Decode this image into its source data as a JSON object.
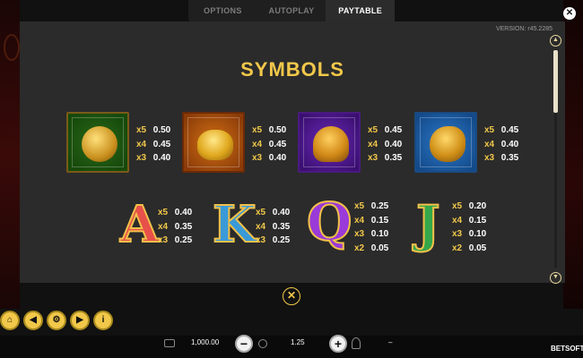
{
  "tabs": [
    {
      "label": "OPTIONS"
    },
    {
      "label": "AUTOPLAY"
    },
    {
      "label": "PAYTABLE"
    }
  ],
  "active_tab": "PAYTABLE",
  "version": "VERSION: r45.2285",
  "paytable": {
    "title": "SYMBOLS",
    "premium": [
      {
        "icon": "buddha-symbol-icon",
        "pays": [
          {
            "mul": "x5",
            "val": "0.50"
          },
          {
            "mul": "x4",
            "val": "0.45"
          },
          {
            "mul": "x3",
            "val": "0.40"
          }
        ]
      },
      {
        "icon": "gold-ingot-symbol-icon",
        "pays": [
          {
            "mul": "x5",
            "val": "0.50"
          },
          {
            "mul": "x4",
            "val": "0.45"
          },
          {
            "mul": "x3",
            "val": "0.40"
          }
        ]
      },
      {
        "icon": "gold-turtle-symbol-icon",
        "pays": [
          {
            "mul": "x5",
            "val": "0.45"
          },
          {
            "mul": "x4",
            "val": "0.40"
          },
          {
            "mul": "x3",
            "val": "0.35"
          }
        ]
      },
      {
        "icon": "money-toad-symbol-icon",
        "pays": [
          {
            "mul": "x5",
            "val": "0.45"
          },
          {
            "mul": "x4",
            "val": "0.40"
          },
          {
            "mul": "x3",
            "val": "0.35"
          }
        ]
      }
    ],
    "letters": [
      {
        "letter": "A",
        "pays": [
          {
            "mul": "x5",
            "val": "0.40"
          },
          {
            "mul": "x4",
            "val": "0.35"
          },
          {
            "mul": "x3",
            "val": "0.25"
          }
        ]
      },
      {
        "letter": "K",
        "pays": [
          {
            "mul": "x5",
            "val": "0.40"
          },
          {
            "mul": "x4",
            "val": "0.35"
          },
          {
            "mul": "x3",
            "val": "0.25"
          }
        ]
      },
      {
        "letter": "Q",
        "pays": [
          {
            "mul": "x5",
            "val": "0.25"
          },
          {
            "mul": "x4",
            "val": "0.15"
          },
          {
            "mul": "x3",
            "val": "0.10"
          },
          {
            "mul": "x2",
            "val": "0.05"
          }
        ]
      },
      {
        "letter": "J",
        "pays": [
          {
            "mul": "x5",
            "val": "0.20"
          },
          {
            "mul": "x4",
            "val": "0.15"
          },
          {
            "mul": "x3",
            "val": "0.10"
          },
          {
            "mul": "x2",
            "val": "0.05"
          }
        ]
      }
    ]
  },
  "footer": {
    "balance": "1,000.00",
    "stake": "1.25",
    "win": "–",
    "brand": "BETSOFT"
  },
  "controls": [
    {
      "icon": "home-icon"
    },
    {
      "icon": "back-icon"
    },
    {
      "icon": "settings-icon"
    },
    {
      "icon": "forward-icon"
    },
    {
      "icon": "info-icon"
    }
  ],
  "colors": {
    "accent": "#f2c84a",
    "panel": "#2b2b2b",
    "text": "#ffffff"
  }
}
